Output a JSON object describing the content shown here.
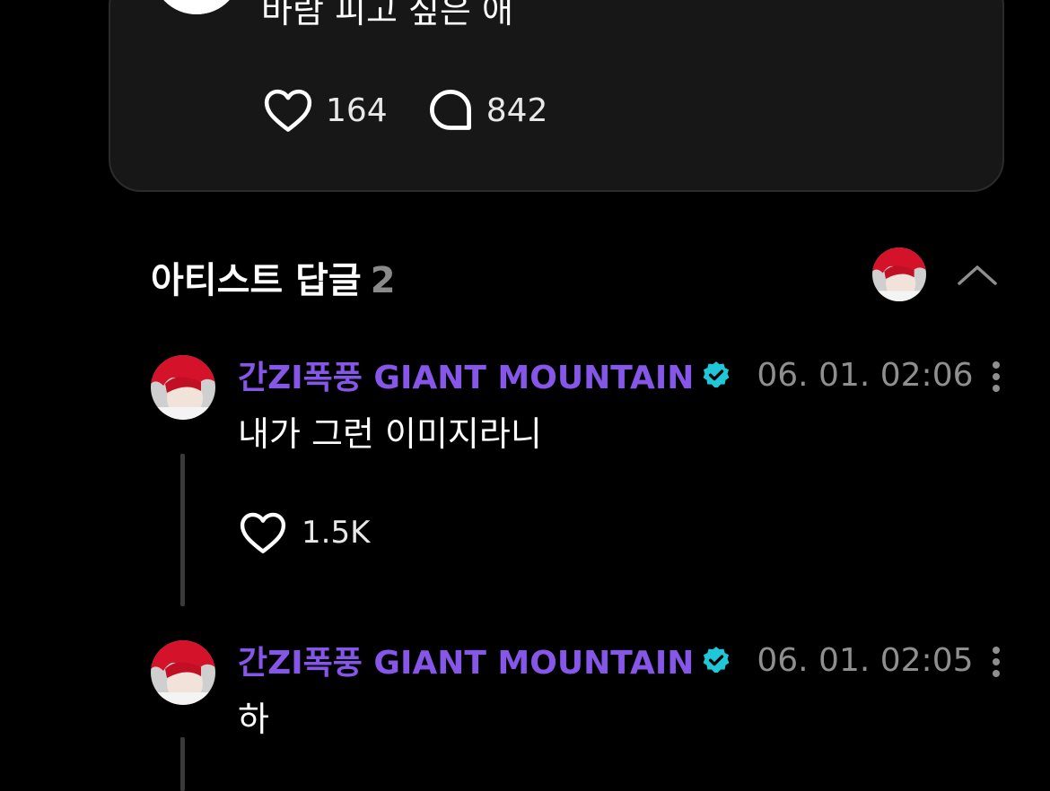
{
  "post": {
    "text": "바람 피고 싶은 애",
    "like_count": "164",
    "comment_count": "842"
  },
  "artist_replies": {
    "title": "아티스트 답글",
    "count": "2",
    "items": [
      {
        "author": "간ZI폭풍 GIANT MOUNTAIN",
        "timestamp": "06. 01. 02:06",
        "text": "내가 그런 이미지라니",
        "like_count": "1.5K"
      },
      {
        "author": "간ZI폭풍 GIANT MOUNTAIN",
        "timestamp": "06. 01. 02:05",
        "text": "하"
      }
    ]
  },
  "icons": {
    "like": "heart-outline-icon",
    "comment": "speech-bubble-icon",
    "verified": "verified-badge-icon",
    "collapse": "chevron-up-icon",
    "more": "vertical-ellipsis-icon"
  },
  "colors": {
    "background": "#000000",
    "card": "#171717",
    "author": "#8656e8",
    "verified": "#1ec8d8",
    "muted_text": "#8f8f8f"
  }
}
